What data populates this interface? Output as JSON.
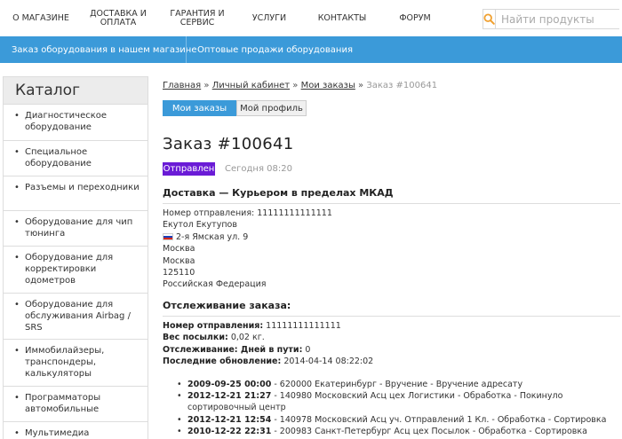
{
  "nav": {
    "items": [
      "О МАГАЗИНЕ",
      "ДОСТАВКА И\nОПЛАТА",
      "ГАРАНТИЯ И\nСЕРВИС",
      "УСЛУГИ",
      "КОНТАКТЫ",
      "ФОРУМ"
    ],
    "search_placeholder": "Найти продукты"
  },
  "subbar": {
    "items": [
      "Заказ оборудования в нашем магазине",
      "Оптовые продажи оборудования"
    ]
  },
  "sidebar": {
    "title": "Каталог",
    "items": [
      "Диагностическое оборудование",
      "Специальное оборудование",
      "Разъемы и переходники",
      "Оборудование для чип тюнинга",
      "Оборудование для корректировки одометров",
      "Оборудование для обслуживания Airbag / SRS",
      "Иммобилайзеры, транспондеры, калькуляторы",
      "Программаторы автомобильные",
      "Мультимедиа"
    ]
  },
  "breadcrumb": {
    "home": "Главная",
    "cabinet": "Личный кабинет",
    "orders": "Мои заказы",
    "current": "Заказ #100641",
    "sep": "»"
  },
  "tabs": {
    "orders": "Мои заказы",
    "profile": "Мой профиль"
  },
  "order": {
    "title": "Заказ #100641",
    "status": "Отправлен",
    "time": "Сегодня 08:20",
    "status_color": "#6a1bd6"
  },
  "delivery": {
    "heading": "Доставка — Курьером в пределах МКАД",
    "lines": [
      "Номер отправления: 11111111111111",
      "Екутол Екутупов",
      "2-я Ямская ул. 9",
      "Москва",
      "Москва",
      "125110",
      "Российская Федерация"
    ]
  },
  "tracking": {
    "heading": "Отслеживание заказа:",
    "info": [
      {
        "label": "Номер отправления:",
        "value": "11111111111111"
      },
      {
        "label": "Вес посылки:",
        "value": "0,02 кг."
      },
      {
        "label": "Отслеживание: Дней в пути:",
        "value": "0"
      },
      {
        "label": "Последние обновление:",
        "value": "2014-04-14 08:22:02"
      }
    ],
    "events": [
      {
        "date": "2009-09-25 00:00",
        "text": "- 620000 Екатеринбург - Вручение - Вручение адресату"
      },
      {
        "date": "2012-12-21 21:27",
        "text": "- 140980 Московский Асц цех Логистики - Обработка - Покинуло сортировочный центр"
      },
      {
        "date": "2012-12-21 12:54",
        "text": "- 140978 Московский Асц уч. Отправлений 1 Кл. - Обработка - Сортировка"
      },
      {
        "date": "2010-12-22 22:31",
        "text": "- 200983 Санкт-Петербург Асц цех Посылок - Обработка - Сортировка"
      }
    ]
  },
  "colors": {
    "accent": "#3b9ad9",
    "search_icon": "#f0a030"
  }
}
